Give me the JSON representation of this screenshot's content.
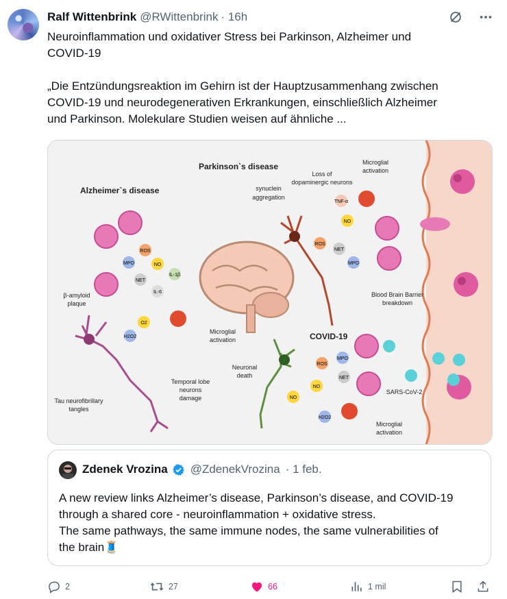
{
  "tweet": {
    "author_name": "Ralf Wittenbrink",
    "handle": "@RWittenbrink",
    "time": "· 16h",
    "text": "Neuroinflammation und oxidativer Stress bei Parkinson, Alzheimer und\nCOVID-19\n\n„Die Entzündungsreaktion im Gehirn ist der Hauptzusammenhang zwischen\nCOVID-19 und neurodegenerativen Erkrankungen, einschließlich Alzheimer\nund Parkinson. Molekulare Studien weisen auf ähnliche ..."
  },
  "figure": {
    "alzheimers": "Alzheimer`s disease",
    "parkinsons": "Parkinson`s disease",
    "covid": "COVID-19",
    "synuclein": "synuclein",
    "aggregation": "aggregation",
    "loss1": "Loss of",
    "loss2": "dopaminergic neurons",
    "mg1": "Microglial",
    "mg2": "activation",
    "beta1": "β-amyloid",
    "beta2": "plaque",
    "tau1": "Tau neurofibrillary",
    "tau2": "tangles",
    "temporal1": "Temporal lobe",
    "temporal2": "neurons",
    "temporal3": "damage",
    "bbb1": "Blood Brain Barrier",
    "bbb2": "breakdown",
    "sars": "SARS-CoV-2",
    "neuronal1": "Neuronal",
    "neuronal2": "death",
    "ros": "ROS",
    "no": "NO",
    "mpo": "MPO",
    "net": "NET",
    "il1b": "IL-1β",
    "il6": "IL-6",
    "tnf": "TNF-α",
    "h2o2": "H2O2",
    "o2": "O2"
  },
  "quote": {
    "author_name": "Zdenek Vrozina",
    "handle": "@ZdenekVrozina",
    "time": "· 1 feb.",
    "text": "A new review links Alzheimer’s disease, Parkinson’s disease, and COVID-19\nthrough a shared core - neuroinflammation + oxidative stress.\nThe same pathways, the same immune nodes, the same vulnerabilities of\nthe brain🧵"
  },
  "actions": {
    "replies": "2",
    "reposts": "27",
    "likes": "66",
    "views": "1 mil"
  },
  "icons": [
    "grok-icon",
    "more-icon",
    "verified-icon",
    "reply-icon",
    "repost-icon",
    "like-icon",
    "views-icon",
    "bookmark-icon",
    "share-icon"
  ],
  "colors": {
    "like": "#f91880",
    "verified": "#1d9bf0",
    "secondary": "#536471"
  }
}
